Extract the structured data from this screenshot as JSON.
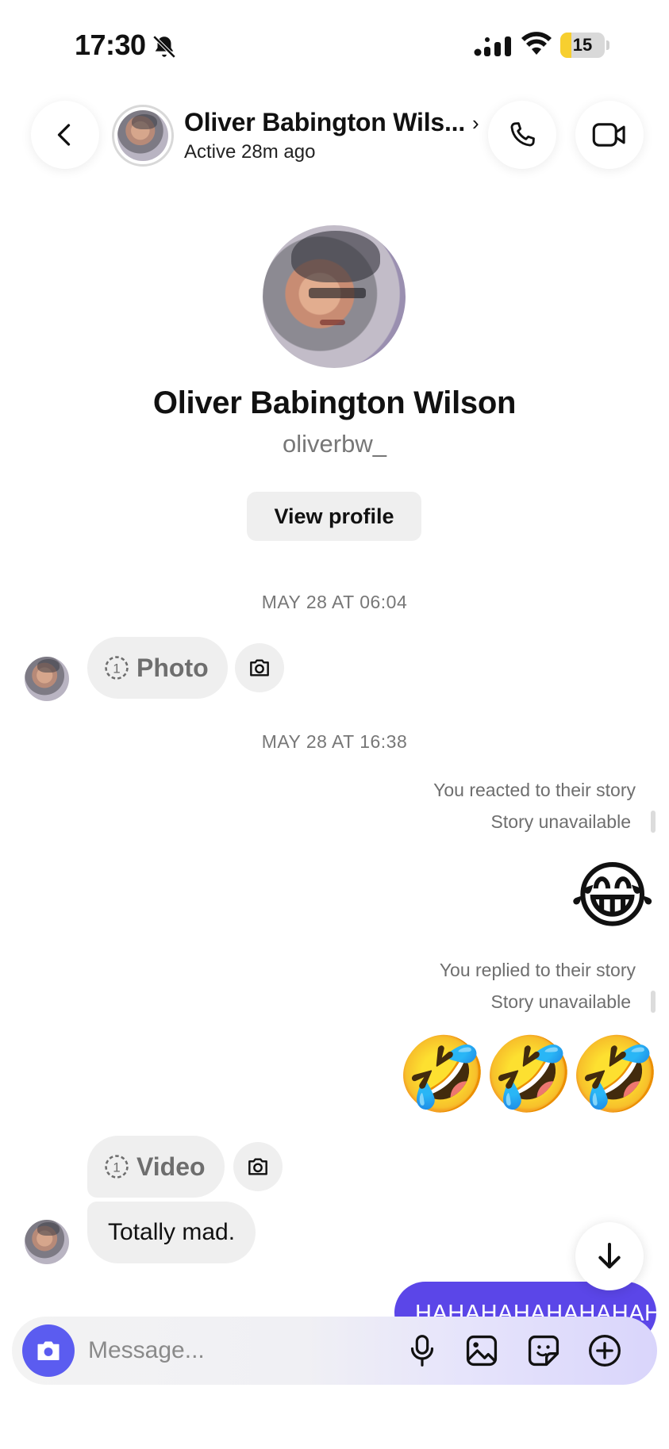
{
  "status_bar": {
    "time": "17:30",
    "battery": "15",
    "battery_level": 0.15,
    "icons": [
      "bell-off-icon",
      "signal-icon",
      "wifi-icon",
      "battery-icon"
    ]
  },
  "header": {
    "name": "Oliver Babington Wils...",
    "chevron": "›",
    "status": "Active 28m ago",
    "icons": [
      "back-icon",
      "phone-icon",
      "video-camera-icon",
      "chevron-right-icon"
    ]
  },
  "profile": {
    "name": "Oliver Babington Wilson",
    "handle": "oliverbw_",
    "view_profile_label": "View profile"
  },
  "conversation": {
    "timestamp_1": "MAY 28 AT 06:04",
    "photo_label": "Photo",
    "timestamp_2": "MAY 28 AT 16:38",
    "reacted_note": "You reacted to their story",
    "story_unavailable_1": "Story unavailable",
    "reaction_emoji": "😂",
    "replied_note": "You replied to their story",
    "story_unavailable_2": "Story unavailable",
    "reply_emojis": [
      "🤣",
      "🤣",
      "🤣"
    ],
    "video_label": "Video",
    "received_text": "Totally mad.",
    "sent_text": "HAHAHAHAHAHAHAH"
  },
  "composer": {
    "placeholder": "Message...",
    "icons": [
      "camera-icon",
      "microphone-icon",
      "gallery-icon",
      "sticker-icon",
      "plus-circle-icon"
    ]
  },
  "colors": {
    "accent": "#5b46e8",
    "composer_camera": "#5b5cf0",
    "bubble_gray": "#efefef",
    "battery_yellow": "#f7cf2f"
  }
}
